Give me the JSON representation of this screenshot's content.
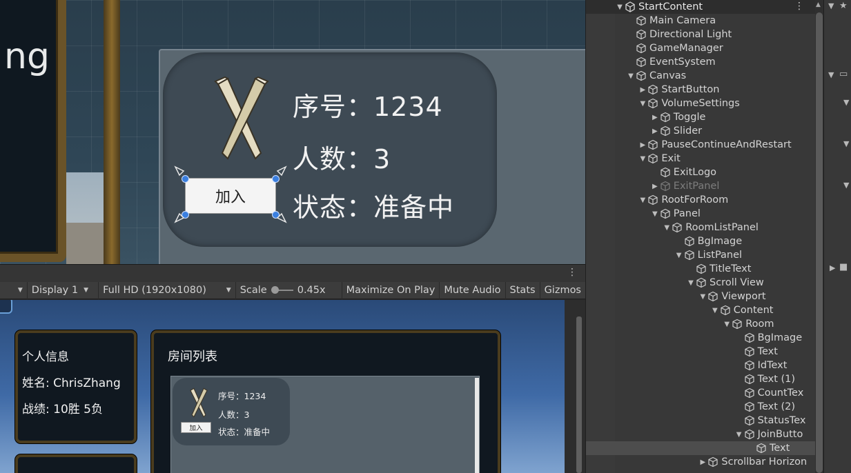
{
  "scene_view": {
    "partial_text_left": "ng",
    "room": {
      "id_line": "序号：1234",
      "count_line": "人数：3",
      "status_line": "状态：准备中",
      "join_label": "加入"
    }
  },
  "game_toolbar": {
    "display": "Display 1",
    "resolution": "Full HD (1920x1080)",
    "scale_label": "Scale",
    "scale_value": "0.45x",
    "maximize": "Maximize On Play",
    "mute": "Mute Audio",
    "stats": "Stats",
    "gizmos": "Gizmos"
  },
  "game_view": {
    "info": {
      "title": "个人信息",
      "name": "姓名:  ChrisZhang",
      "record": "战绩:  10胜    5负"
    },
    "rooms": {
      "title": "房间列表",
      "id_line": "序号：1234",
      "count_line": "人数：3",
      "status_line": "状态：准备中",
      "join_label": "加入"
    }
  },
  "hierarchy": {
    "scene_name": "StartContent",
    "items": [
      {
        "label": "Main Camera",
        "depth": 1,
        "fold": ""
      },
      {
        "label": "Directional Light",
        "depth": 1,
        "fold": ""
      },
      {
        "label": "GameManager",
        "depth": 1,
        "fold": ""
      },
      {
        "label": "EventSystem",
        "depth": 1,
        "fold": ""
      },
      {
        "label": "Canvas",
        "depth": 1,
        "fold": "open"
      },
      {
        "label": "StartButton",
        "depth": 2,
        "fold": "closed"
      },
      {
        "label": "VolumeSettings",
        "depth": 2,
        "fold": "open"
      },
      {
        "label": "Toggle",
        "depth": 3,
        "fold": "closed"
      },
      {
        "label": "Slider",
        "depth": 3,
        "fold": "closed"
      },
      {
        "label": "PauseContinueAndRestart",
        "depth": 2,
        "fold": "closed"
      },
      {
        "label": "Exit",
        "depth": 2,
        "fold": "open"
      },
      {
        "label": "ExitLogo",
        "depth": 3,
        "fold": ""
      },
      {
        "label": "ExitPanel",
        "depth": 3,
        "fold": "closed",
        "disabled": true
      },
      {
        "label": "RootForRoom",
        "depth": 2,
        "fold": "open"
      },
      {
        "label": "Panel",
        "depth": 3,
        "fold": "open"
      },
      {
        "label": "RoomListPanel",
        "depth": 4,
        "fold": "open"
      },
      {
        "label": "BgImage",
        "depth": 5,
        "fold": ""
      },
      {
        "label": "ListPanel",
        "depth": 5,
        "fold": "open"
      },
      {
        "label": "TitleText",
        "depth": 6,
        "fold": ""
      },
      {
        "label": "Scroll View",
        "depth": 6,
        "fold": "open"
      },
      {
        "label": "Viewport",
        "depth": 7,
        "fold": "open"
      },
      {
        "label": "Content",
        "depth": 8,
        "fold": "open"
      },
      {
        "label": "Room",
        "depth": 9,
        "fold": "open"
      },
      {
        "label": "BgImage",
        "depth": 10,
        "fold": ""
      },
      {
        "label": "Text",
        "depth": 10,
        "fold": ""
      },
      {
        "label": "IdText",
        "depth": 10,
        "fold": ""
      },
      {
        "label": "Text (1)",
        "depth": 10,
        "fold": ""
      },
      {
        "label": "CountTex",
        "depth": 10,
        "fold": ""
      },
      {
        "label": "Text (2)",
        "depth": 10,
        "fold": ""
      },
      {
        "label": "StatusTex",
        "depth": 10,
        "fold": ""
      },
      {
        "label": "JoinButto",
        "depth": 10,
        "fold": "open"
      },
      {
        "label": "Text",
        "depth": 11,
        "fold": "",
        "selected": true
      },
      {
        "label": "Scrollbar Horizon",
        "depth": 7,
        "fold": "closed"
      }
    ]
  }
}
